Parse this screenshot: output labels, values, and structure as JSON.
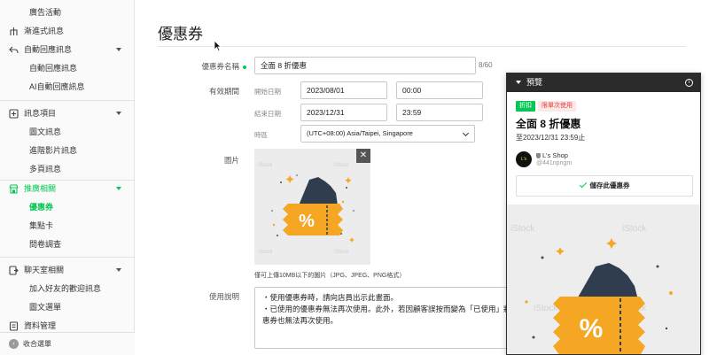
{
  "sidebar": {
    "items": [
      {
        "label": "廣告活動"
      },
      {
        "label": "漸進式訊息"
      },
      {
        "label": "自動回應訊息"
      },
      {
        "label": "自動回應訊息"
      },
      {
        "label": "AI自動回應訊息"
      },
      {
        "label": "訊息項目"
      },
      {
        "label": "圖文訊息"
      },
      {
        "label": "進階影片訊息"
      },
      {
        "label": "多頁訊息"
      },
      {
        "label": "推廣相關"
      },
      {
        "label": "優惠券"
      },
      {
        "label": "集點卡"
      },
      {
        "label": "問卷調查"
      },
      {
        "label": "聊天室相關"
      },
      {
        "label": "加入好友的歡迎訊息"
      },
      {
        "label": "圖文選單"
      },
      {
        "label": "資料管理"
      }
    ],
    "footer_label": "收合選單"
  },
  "main": {
    "title": "優惠券",
    "name_label": "優惠券名稱",
    "name_value": "全面 8 折優惠",
    "name_counter": "8/60",
    "period_label": "有效期間",
    "start_label": "開始日期",
    "start_date": "2023/08/01",
    "start_time": "00:00",
    "end_label": "結束日期",
    "end_date": "2023/12/31",
    "end_time": "23:59",
    "tz_label": "時區",
    "tz_value": "(UTC+08:00) Asia/Taipei, Singapore",
    "image_label": "圖片",
    "image_close": "✕",
    "image_note": "僅可上傳10MB以下的圖片（JPG、JPEG、PNG格式）",
    "usage_label": "使用說明",
    "usage_lines": [
      "・使用優惠券時，請向店員出示此畫面。",
      "・已使用的優惠券無法再次使用。此外，若因顧客誤按而變為「已使用」狀態",
      "惠券也無法再次使用。"
    ]
  },
  "preview": {
    "header": "預覽",
    "info_icon": "i",
    "badge_type": "折扣",
    "badge_limit": "限單次使用",
    "coupon_title": "全面 8 折優惠",
    "expiry": "至2023/12/31 23:59止",
    "shop_name": "L's Shop",
    "shop_id": "@441npngm",
    "avatar_text": "L's",
    "save_label": "儲存此優惠券"
  },
  "coupon_image": {
    "symbol": "%",
    "watermark": "iStock",
    "colors": {
      "ticket": "#f5a623",
      "pocket": "#2f3d4f",
      "background": "#ececec"
    }
  },
  "colors": {
    "accent": "#06c755",
    "badge_red": "#e0413e",
    "preview_header": "#2b2b2b"
  }
}
